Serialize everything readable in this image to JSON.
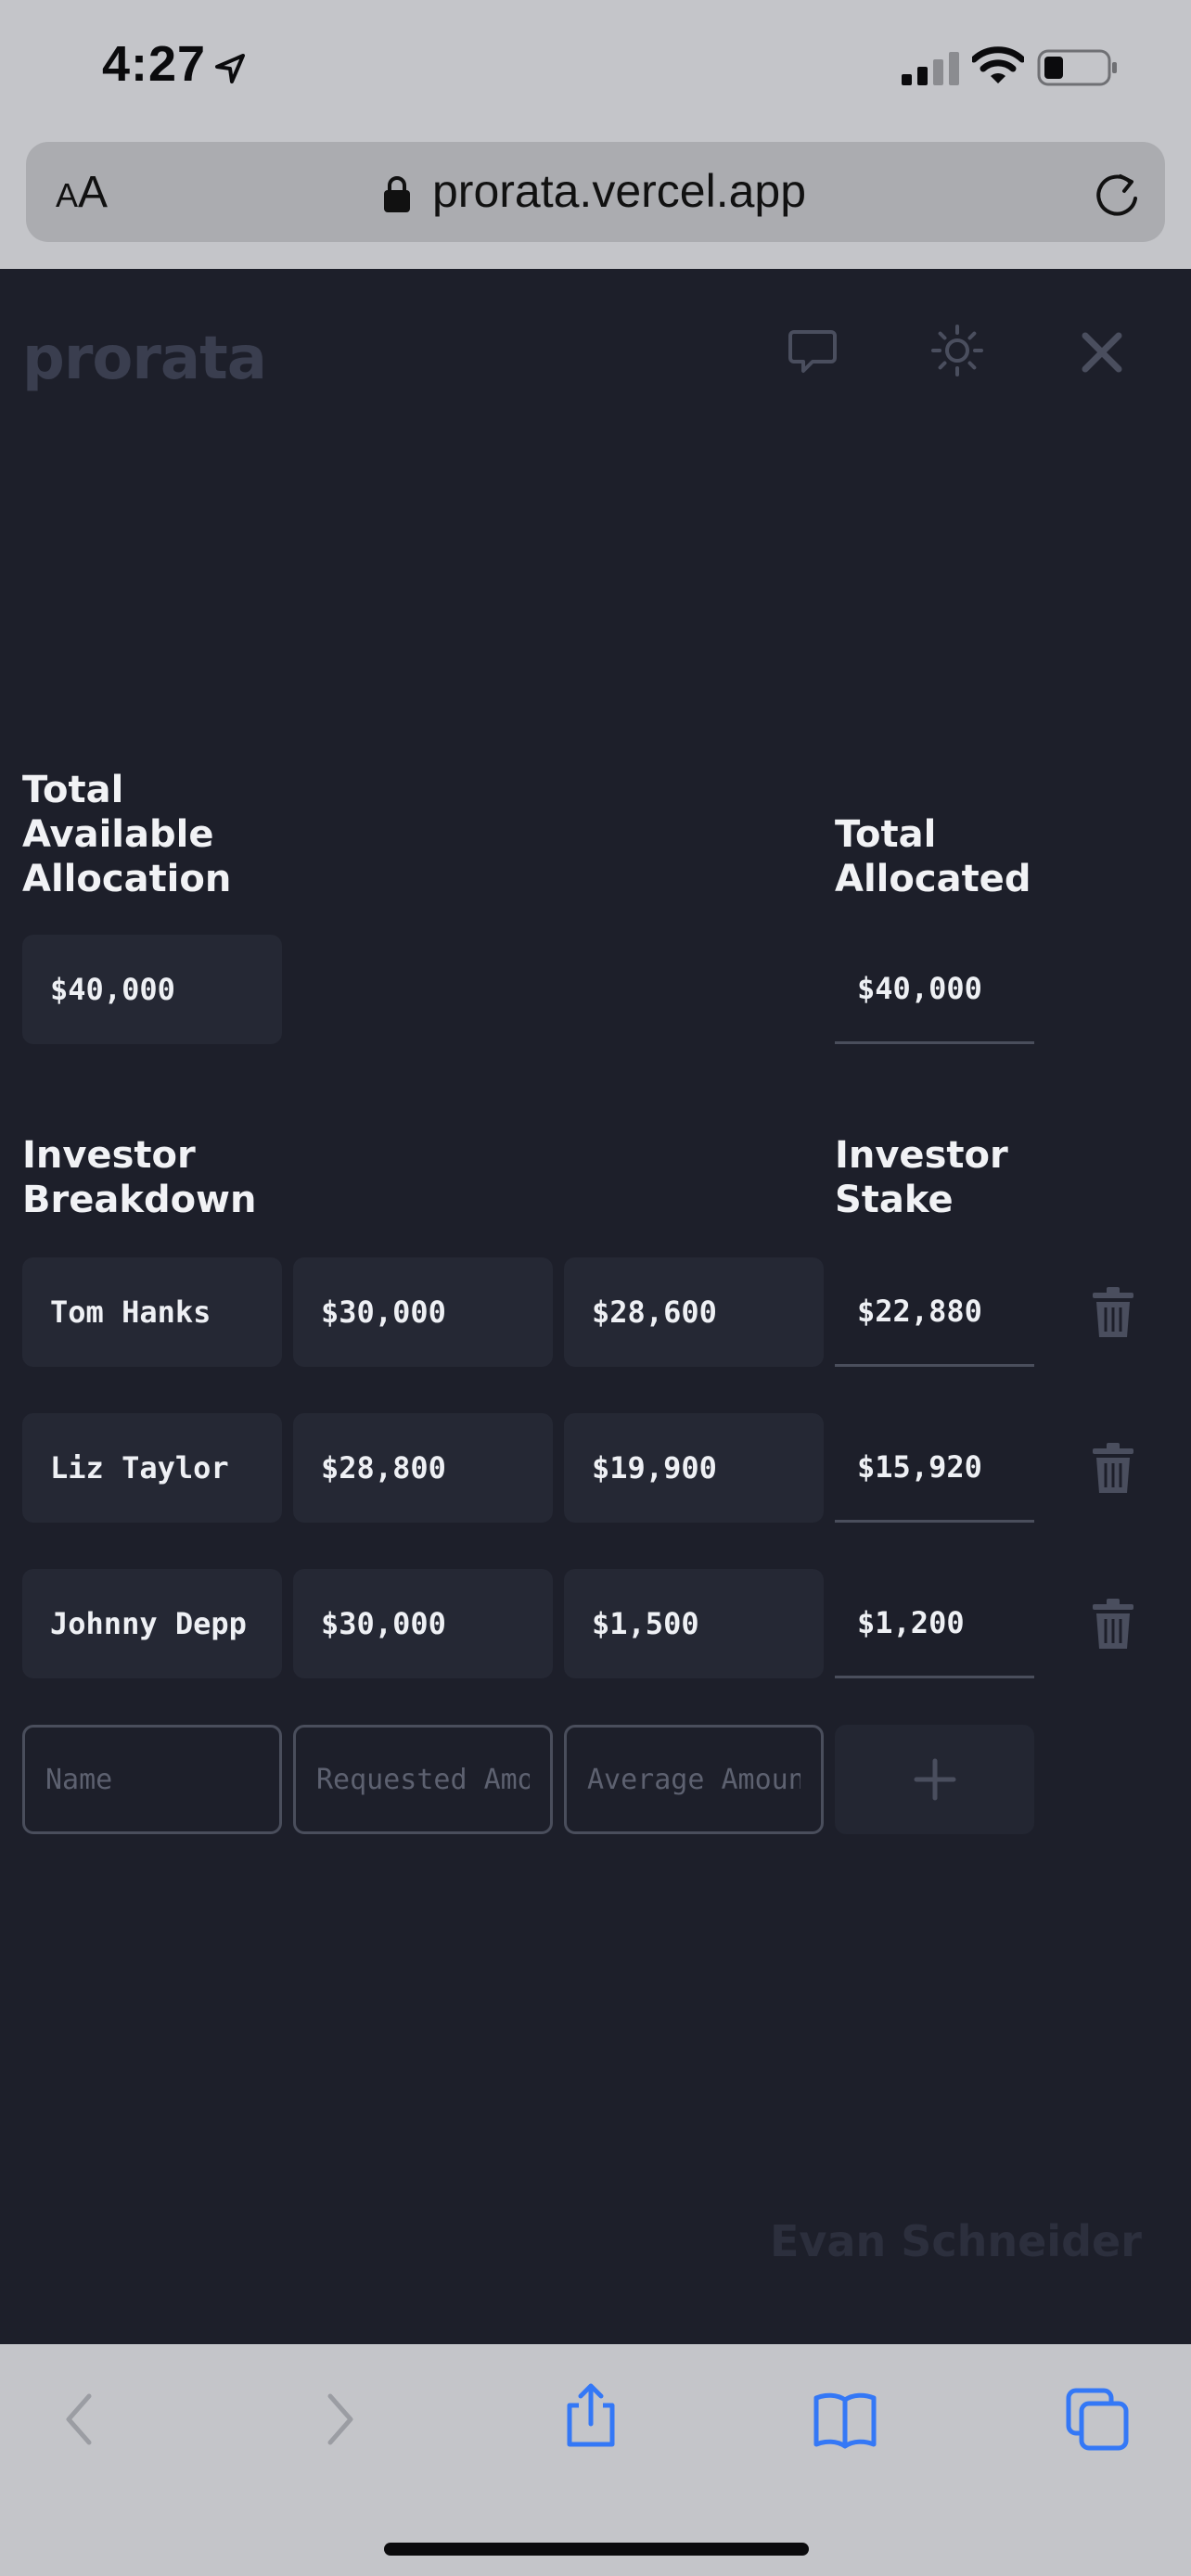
{
  "status_bar": {
    "time": "4:27"
  },
  "browser": {
    "text_size_small": "A",
    "text_size_big": "A",
    "url": "prorata.vercel.app"
  },
  "app": {
    "logo": "prorata",
    "total_available": {
      "heading": "Total Available Allocation",
      "value": "$40,000"
    },
    "total_allocated": {
      "heading": "Total Allocated",
      "value": "$40,000"
    },
    "breakdown_heading": "Investor Breakdown",
    "stake_heading": "Investor Stake",
    "investors": [
      {
        "name": "Tom Hanks",
        "requested": "$30,000",
        "average": "$28,600",
        "stake": "$22,880"
      },
      {
        "name": "Liz Taylor",
        "requested": "$28,800",
        "average": "$19,900",
        "stake": "$15,920"
      },
      {
        "name": "Johnny Depp",
        "requested": "$30,000",
        "average": "$1,500",
        "stake": "$1,200"
      }
    ],
    "new_row": {
      "name_placeholder": "Name",
      "requested_placeholder": "Requested Amount",
      "average_placeholder": "Average Amount"
    },
    "author": "Evan Schneider"
  },
  "icons": {
    "header": [
      "chat-icon",
      "sun-icon",
      "close-icon"
    ],
    "toolbar": [
      "back-icon",
      "forward-icon",
      "share-icon",
      "bookmarks-icon",
      "tabs-icon"
    ]
  },
  "colors": {
    "background": "#1d1f2a",
    "field": "#252834",
    "logo": "#3a3e4f",
    "safari_blue": "#3478f6"
  }
}
